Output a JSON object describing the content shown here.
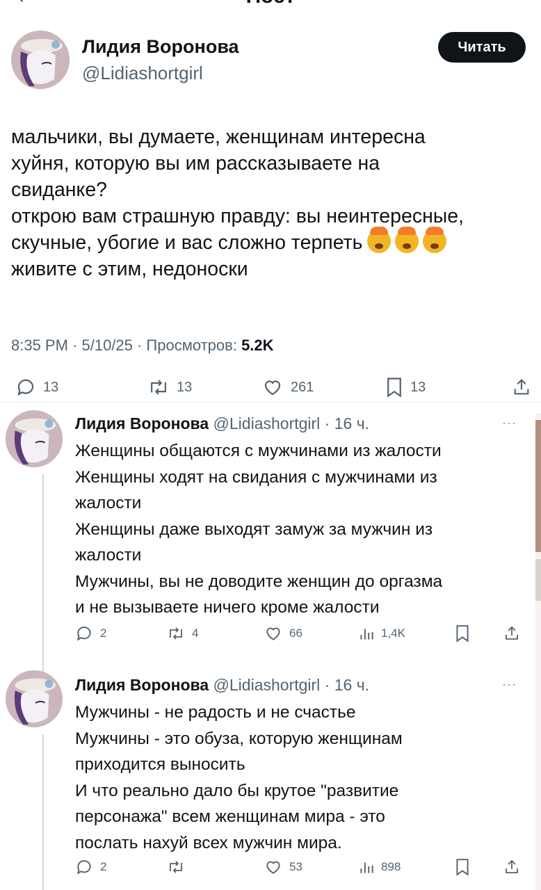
{
  "header": {
    "title": "Пост"
  },
  "main_tweet": {
    "author_name": "Лидия Воронова",
    "author_handle": "@Lidiashortgirl",
    "follow_label": "Читать",
    "text_lines": [
      "мальчики, вы думаете, женщинам интересна",
      "хуйня, которую вы им рассказываете на",
      "свиданке?",
      "открою вам страшную правду: вы неинтересные,",
      "скучные, убогие и вас сложно терпеть",
      "живите с этим, недоноски"
    ],
    "emoji_name": "exploding-head-emoji",
    "meta_prefix": "8:35 PM · 5/10/25 · Просмотров: ",
    "meta_views": "5.2K",
    "actions": {
      "replies": "13",
      "reposts": "13",
      "likes": "261",
      "bookmarks": "13"
    }
  },
  "replies": [
    {
      "author_name": "Лидия Воронова",
      "author_meta": " @Lidiashortgirl · 16 ч.",
      "more": "···",
      "text_lines": [
        "Женщины общаются с мужчинами из жалости",
        "Женщины ходят на свидания с мужчинами из",
        "жалости",
        "Женщины даже выходят замуж за мужчин из",
        "жалости",
        "Мужчины, вы не доводите женщин до оргазма",
        "и не вызываете ничего кроме жалости"
      ],
      "actions": {
        "replies": "2",
        "reposts": "4",
        "likes": "66",
        "views": "1,4K"
      }
    },
    {
      "author_name": "Лидия Воронова",
      "author_meta": " @Lidiashortgirl · 16 ч.",
      "more": "···",
      "text_lines": [
        "Мужчины - не радость и не счастье",
        "Мужчины - это обуза, которую женщинам",
        "приходится выносить",
        "И что реально дало бы крутое \"развитие",
        "персонажа\" всем женщинам мира - это",
        "послать нахуй всех мужчин мира."
      ],
      "actions": {
        "replies": "2",
        "reposts": "",
        "likes": "53",
        "views": "898"
      }
    }
  ],
  "colors": {
    "text": "#0f1419",
    "secondary": "#536471",
    "button": "#0f1419",
    "line": "#cfd9de"
  }
}
